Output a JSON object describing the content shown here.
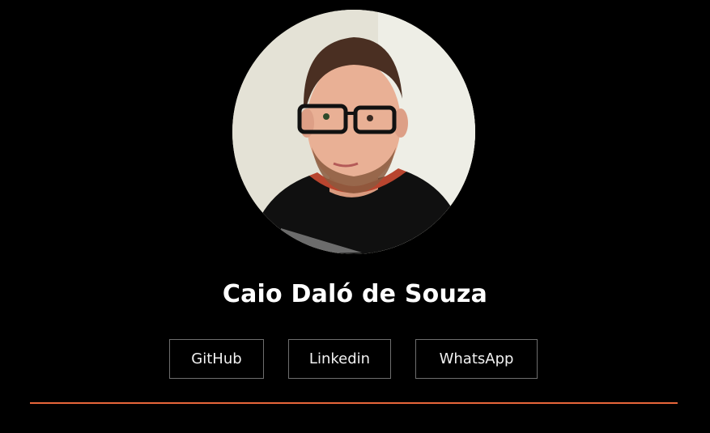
{
  "profile": {
    "name": "Caio Daló de Souza"
  },
  "links": [
    {
      "label": "GitHub"
    },
    {
      "label": "Linkedin"
    },
    {
      "label": "WhatsApp"
    }
  ],
  "colors": {
    "background": "#000000",
    "accent": "#e8663a",
    "button_border": "#6e6e6e",
    "text": "#ffffff"
  }
}
